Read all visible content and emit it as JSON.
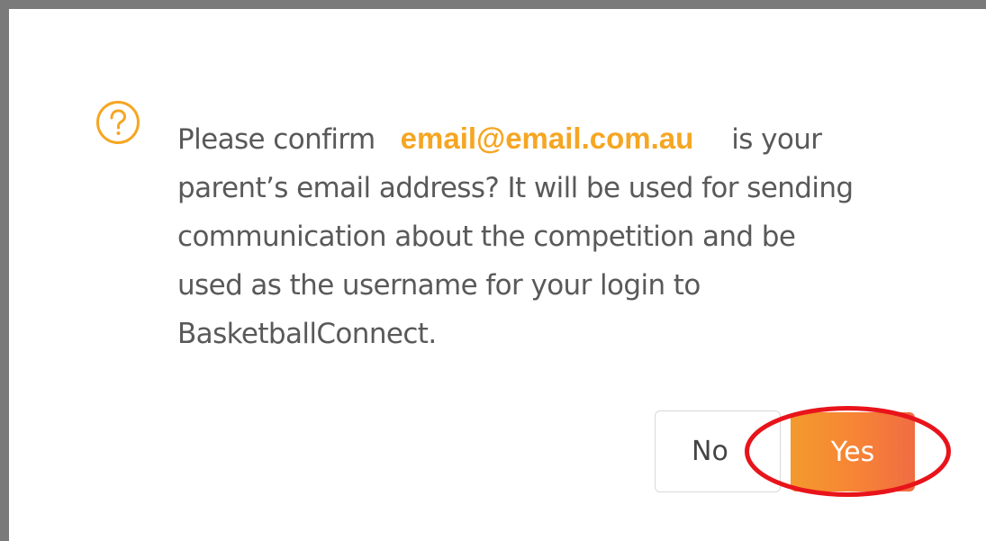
{
  "dialog": {
    "message_lines": [
      "Please confirm",
      "is your",
      "parent’s email address? It will be used for sending",
      "communication about the competition and be",
      "used as the username for your login to",
      "BasketballConnect."
    ],
    "email": "email@email.com.au",
    "icon": "question-circle-icon",
    "no_label": "No",
    "yes_label": "Yes"
  },
  "colors": {
    "accent": "#f5a623",
    "yes_button": "#f78336",
    "highlight_ring": "#e8141b",
    "text": "#595959"
  }
}
